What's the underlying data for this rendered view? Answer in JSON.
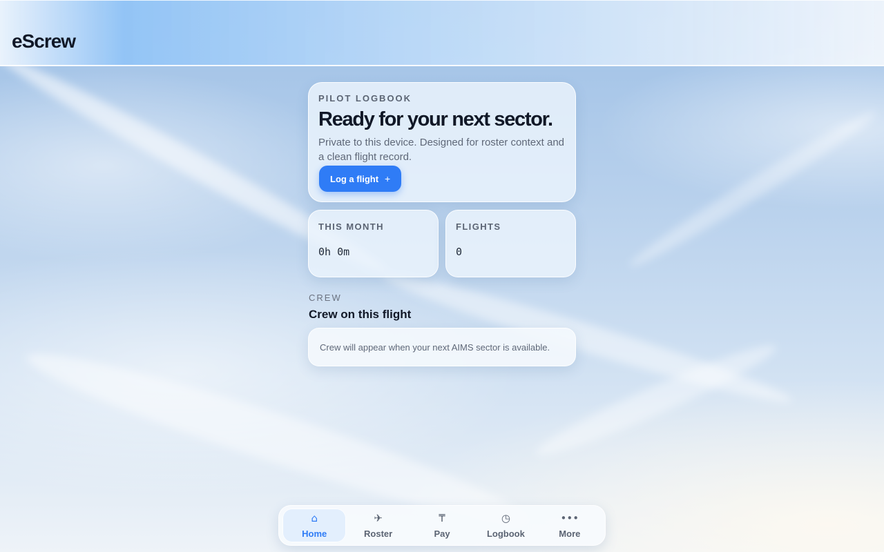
{
  "app": {
    "title": "eScrew"
  },
  "hero": {
    "eyebrow": "PILOT LOGBOOK",
    "title": "Ready for your next sector.",
    "subtitle": "Private to this device. Designed for roster context and a clean flight record.",
    "button_label": "Log a flight",
    "button_icon": "+"
  },
  "stats": {
    "this_month": {
      "label": "THIS MONTH",
      "value": "0h 0m"
    },
    "flights": {
      "label": "FLIGHTS",
      "value": "0"
    }
  },
  "crew": {
    "eyebrow": "CREW",
    "title": "Crew on this flight",
    "empty_message": "Crew will appear when your next AIMS sector is available."
  },
  "tabbar": {
    "tabs": [
      {
        "label": "Home",
        "icon": "⌂",
        "icon_name": "home-icon",
        "active": true
      },
      {
        "label": "Roster",
        "icon": "✈",
        "icon_name": "plane-icon",
        "active": false
      },
      {
        "label": "Pay",
        "icon": "₸",
        "icon_name": "pay-icon",
        "active": false
      },
      {
        "label": "Logbook",
        "icon": "◷",
        "icon_name": "clock-icon",
        "active": false
      },
      {
        "label": "More",
        "icon": "•••",
        "icon_name": "more-icon",
        "active": false
      }
    ]
  },
  "colors": {
    "accent": "#2f7cf6",
    "text_primary": "#111827",
    "text_muted": "#5b6473"
  }
}
